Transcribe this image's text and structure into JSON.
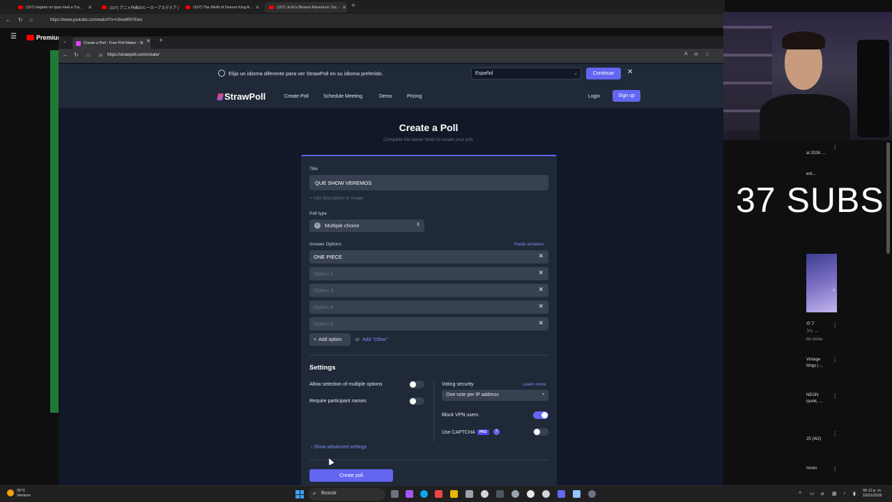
{
  "outer_browser": {
    "tabs": [
      "(107) Hajime no Ippo Had a Tra...",
      "(107) アニメ作画のヒーローアカデミア | Pr...",
      "(107) The Misfit of Demon King A...",
      "(107) JoJo's Bizarre Adventure: Go..."
    ],
    "url": "https://www.youtube.com/watch?v=Ubve8lNYEws",
    "yt_logo": "Premium"
  },
  "inner_browser": {
    "tab_title": "Create a Poll - Free Poll Maker - St",
    "url": "https://strawpoll.com/create/"
  },
  "language_banner": {
    "text": "Elija un idioma diferente para ver StrawPoll en su idioma preferido.",
    "selected_language": "Español",
    "continue_label": "Continuar"
  },
  "site_nav": {
    "brand": "StrawPoll",
    "links": [
      "Create Poll",
      "Schedule Meeting",
      "Demo",
      "Pricing"
    ],
    "login": "Login",
    "signup": "Sign up"
  },
  "page": {
    "heading": "Create a Poll",
    "subheading": "Complete the below fields to create your poll."
  },
  "form": {
    "title_label": "Title",
    "title_value": "QUE SHOW VEREMOS",
    "add_description": "Add description or image",
    "poll_type_label": "Poll type",
    "poll_type_value": "Multiple choice",
    "answer_options_label": "Answer Options",
    "paste_answers": "Paste answers",
    "options": [
      {
        "value": "ONE PIECE",
        "placeholder": ""
      },
      {
        "value": "",
        "placeholder": "Option 2"
      },
      {
        "value": "",
        "placeholder": "Option 3"
      },
      {
        "value": "",
        "placeholder": "Option 4"
      },
      {
        "value": "",
        "placeholder": "Option 5"
      }
    ],
    "add_option": "Add option",
    "or": "or",
    "add_other": "Add \"Other\"",
    "settings_heading": "Settings",
    "allow_multiple": "Allow selection of multiple options",
    "allow_multiple_on": false,
    "require_names": "Require participant names",
    "require_names_on": false,
    "voting_security_label": "Voting security",
    "learn_more": "Learn more",
    "voting_security_value": "One vote per IP address",
    "block_vpn": "Block VPN users",
    "block_vpn_on": true,
    "use_captcha": "Use CAPTCHA",
    "pro_badge": "PRO",
    "use_captcha_on": false,
    "show_advanced": "Show advanced settings",
    "create_poll": "Create poll"
  },
  "overlay": {
    "subs_text": "37 SUBS"
  },
  "right_column": {
    "items": [
      "al 2026: ...",
      "ertí...",
      "のフ",
      "ン」...",
      "de vistas",
      "Vintage",
      "ttings | ...",
      "NEON",
      "rpunk, ...",
      "25 (W2)",
      "rieren"
    ]
  },
  "taskbar": {
    "temperature": "25°C",
    "condition": "Ventoso",
    "search": "Buscar",
    "time": "06:12 p. m.",
    "date": "10/01/2026"
  },
  "colors": {
    "accent": "#6366f1",
    "card_bg": "#1f2937",
    "page_bg": "#111827",
    "input_bg": "#374151"
  }
}
